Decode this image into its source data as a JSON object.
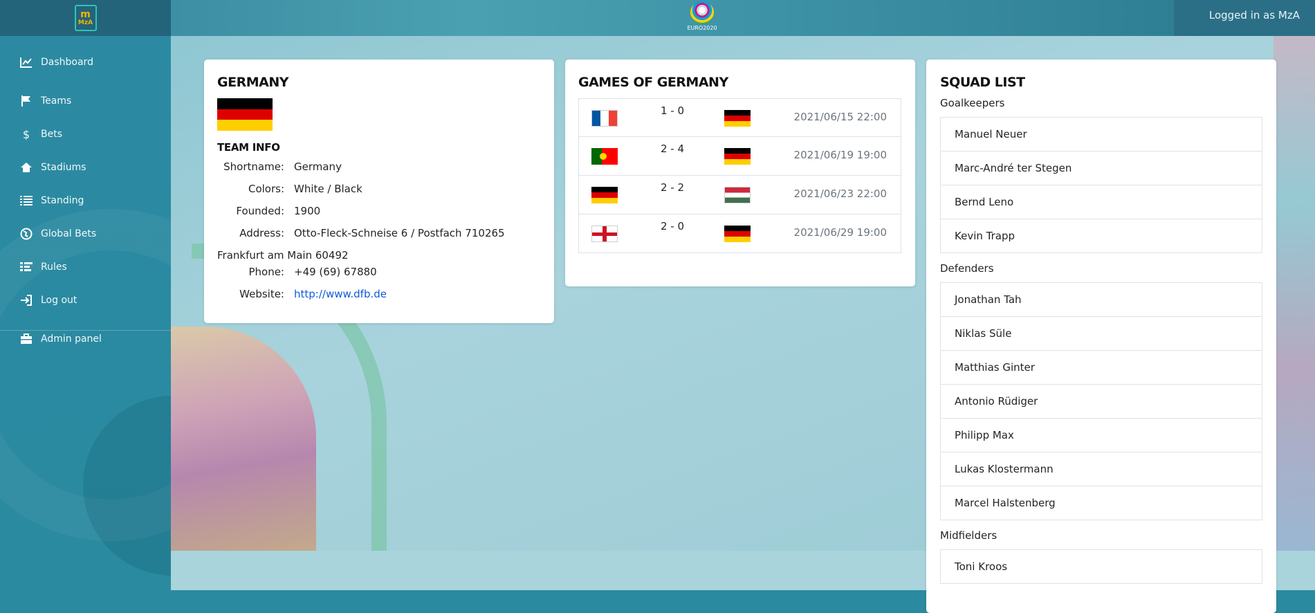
{
  "header": {
    "logo_text": "MzA",
    "euro_logo_text": "EURO2020",
    "logged_in": "Logged in as MzA"
  },
  "sidebar": {
    "items": [
      {
        "label": "Dashboard",
        "icon": "chart-line-icon"
      },
      {
        "label": "Teams",
        "icon": "flag-icon"
      },
      {
        "label": "Bets",
        "icon": "dollar-icon"
      },
      {
        "label": "Stadiums",
        "icon": "home-icon"
      },
      {
        "label": "Standing",
        "icon": "list-icon"
      },
      {
        "label": "Global Bets",
        "icon": "globe-icon"
      },
      {
        "label": "Rules",
        "icon": "list-ordered-icon"
      },
      {
        "label": "Log out",
        "icon": "logout-icon"
      },
      {
        "label": "Admin panel",
        "icon": "briefcase-icon"
      }
    ]
  },
  "team": {
    "title": "GERMANY",
    "section": "TEAM INFO",
    "shortname_label": "Shortname:",
    "shortname": "Germany",
    "colors_label": "Colors:",
    "colors": "White / Black",
    "founded_label": "Founded:",
    "founded": "1900",
    "address_label": "Address:",
    "address_line1": "Otto-Fleck-Schneise 6 / Postfach 710265",
    "address_line2": "Frankfurt am Main 60492",
    "phone_label": "Phone:",
    "phone": "+49 (69) 67880",
    "website_label": "Website:",
    "website": "http://www.dfb.de"
  },
  "games": {
    "title": "GAMES OF GERMANY",
    "rows": [
      {
        "home": "France",
        "score": "1 - 0",
        "away": "Germany",
        "date": "2021/06/15 22:00"
      },
      {
        "home": "Portugal",
        "score": "2 - 4",
        "away": "Germany",
        "date": "2021/06/19 19:00"
      },
      {
        "home": "Germany",
        "score": "2 - 2",
        "away": "Hungary",
        "date": "2021/06/23 22:00"
      },
      {
        "home": "England",
        "score": "2 - 0",
        "away": "Germany",
        "date": "2021/06/29 19:00"
      }
    ]
  },
  "squad": {
    "title": "SQUAD LIST",
    "goalkeepers_label": "Goalkeepers",
    "goalkeepers": [
      "Manuel Neuer",
      "Marc-André ter Stegen",
      "Bernd Leno",
      "Kevin Trapp"
    ],
    "defenders_label": "Defenders",
    "defenders": [
      "Jonathan Tah",
      "Niklas Süle",
      "Matthias Ginter",
      "Antonio Rüdiger",
      "Philipp Max",
      "Lukas Klostermann",
      "Marcel Halstenberg"
    ],
    "midfielders_label": "Midfielders",
    "midfielders": [
      "Toni Kroos"
    ]
  }
}
